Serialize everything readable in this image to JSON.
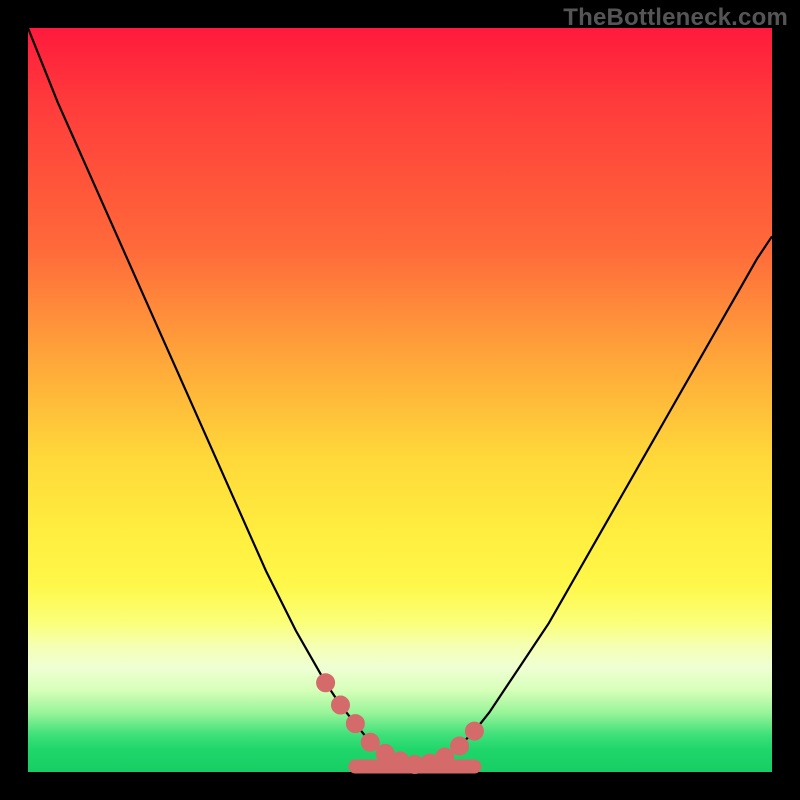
{
  "watermark": {
    "text": "TheBottleneck.com"
  },
  "colors": {
    "bg": "#000000",
    "curve_stroke": "#000000",
    "marker_fill": "#d46a6a",
    "marker_stroke": "#d46a6a",
    "baseline_fill": "#d46a6a"
  },
  "chart_data": {
    "type": "line",
    "title": "",
    "xlabel": "",
    "ylabel": "",
    "xlim": [
      0,
      100
    ],
    "ylim": [
      0,
      100
    ],
    "x": [
      0,
      2,
      4,
      6,
      8,
      10,
      12,
      14,
      16,
      18,
      20,
      22,
      24,
      26,
      28,
      30,
      32,
      34,
      36,
      38,
      40,
      42,
      44,
      46,
      48,
      50,
      52,
      54,
      56,
      58,
      60,
      62,
      64,
      66,
      68,
      70,
      72,
      74,
      76,
      78,
      80,
      82,
      84,
      86,
      88,
      90,
      92,
      94,
      96,
      98,
      100
    ],
    "values": [
      100,
      95,
      90,
      85.5,
      81,
      76.5,
      72,
      67.5,
      63,
      58.5,
      54,
      49.5,
      45,
      40.5,
      36,
      31.5,
      27,
      23,
      19,
      15.5,
      12,
      9,
      6.5,
      4,
      2.5,
      1.5,
      1,
      1.2,
      2,
      3.5,
      5.5,
      8,
      11,
      14,
      17,
      20,
      23.5,
      27,
      30.5,
      34,
      37.5,
      41,
      44.5,
      48,
      51.5,
      55,
      58.5,
      62,
      65.5,
      69,
      72
    ],
    "markers_x": [
      40,
      42,
      44,
      46,
      48,
      50,
      52,
      54,
      56,
      58,
      60
    ],
    "markers_y": [
      12,
      9,
      6.5,
      4,
      2.5,
      1.5,
      1,
      1.2,
      2,
      3.5,
      5.5
    ],
    "min_band": {
      "x0": 44,
      "x1": 60,
      "y": 1.0
    }
  }
}
